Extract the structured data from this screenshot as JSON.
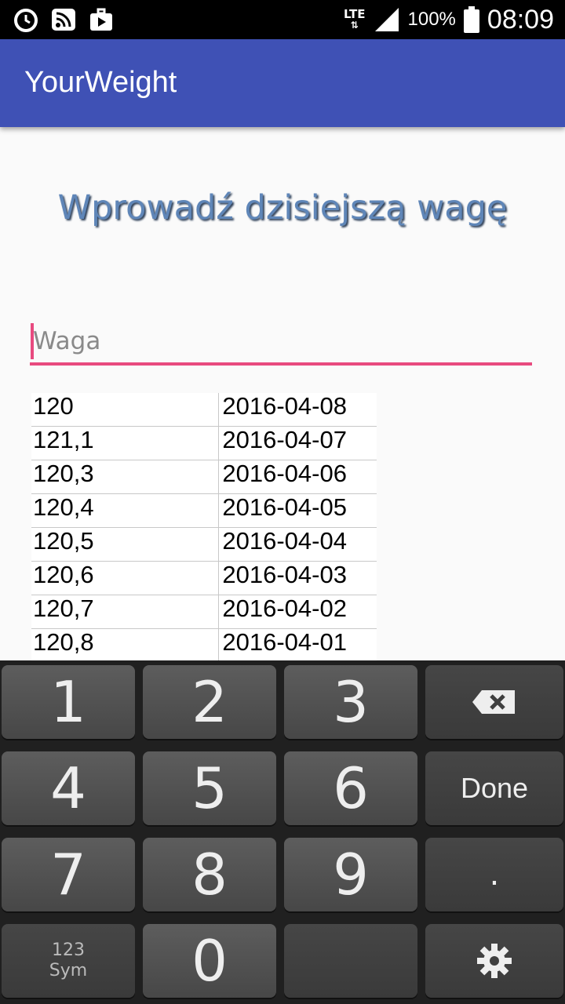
{
  "status_bar": {
    "left_icons": [
      "alarm-icon",
      "cast-icon",
      "media-icon"
    ],
    "network": "LTE",
    "battery": "100%",
    "time": "08:09"
  },
  "app_bar": {
    "title": "YourWeight"
  },
  "heading": "Wprowadź dzisiejszą wagę",
  "weight_input": {
    "placeholder": "Waga",
    "value": ""
  },
  "history": [
    {
      "weight": "120",
      "date": "2016-04-08"
    },
    {
      "weight": "121,1",
      "date": "2016-04-07"
    },
    {
      "weight": "120,3",
      "date": "2016-04-06"
    },
    {
      "weight": "120,4",
      "date": "2016-04-05"
    },
    {
      "weight": "120,5",
      "date": "2016-04-04"
    },
    {
      "weight": "120,6",
      "date": "2016-04-03"
    },
    {
      "weight": "120,7",
      "date": "2016-04-02"
    },
    {
      "weight": "120,8",
      "date": "2016-04-01"
    }
  ],
  "keyboard": {
    "k1": "1",
    "k2": "2",
    "k3": "3",
    "k4": "4",
    "k5": "5",
    "k6": "6",
    "k7": "7",
    "k8": "8",
    "k9": "9",
    "k0": "0",
    "done": "Done",
    "period": ".",
    "sym_top": "123",
    "sym_bottom": "Sym",
    "backspace_icon": "backspace-icon",
    "settings_icon": "gear-icon"
  },
  "colors": {
    "primary": "#3f51b5",
    "accent": "#e84a7f",
    "heading": "#5f86b8"
  }
}
